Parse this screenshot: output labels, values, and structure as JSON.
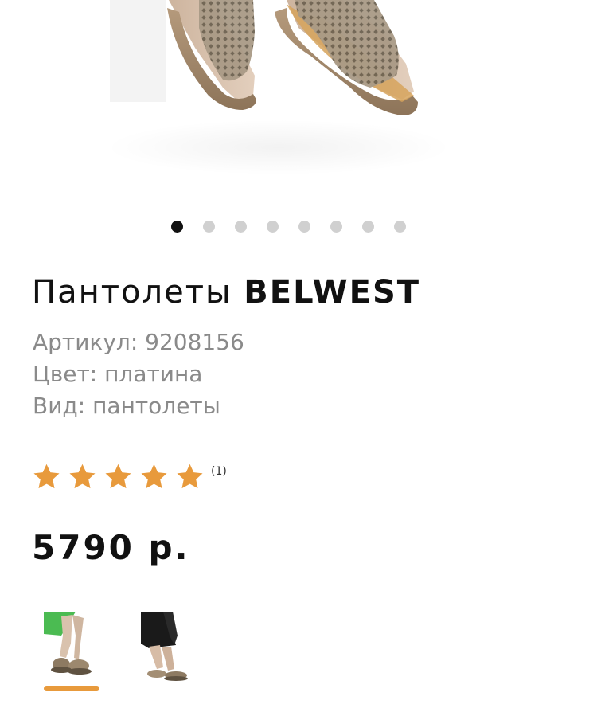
{
  "gallery": {
    "image_alt": "pantolette-photo",
    "dots_total": 8,
    "dots_active_index": 0
  },
  "product": {
    "title_prefix": "Пантолеты",
    "brand": "BELWEST",
    "article": "Артикул: 9208156",
    "color": "Цвет: платина",
    "type": "Вид: пантолеты"
  },
  "rating": {
    "stars": 5,
    "max_stars": 5,
    "count_label": "(1)",
    "star_color": "#e89a3c"
  },
  "price": {
    "label": "5790 р."
  },
  "variants": {
    "selected_index": 0,
    "accent_color": "#e89a3c"
  }
}
